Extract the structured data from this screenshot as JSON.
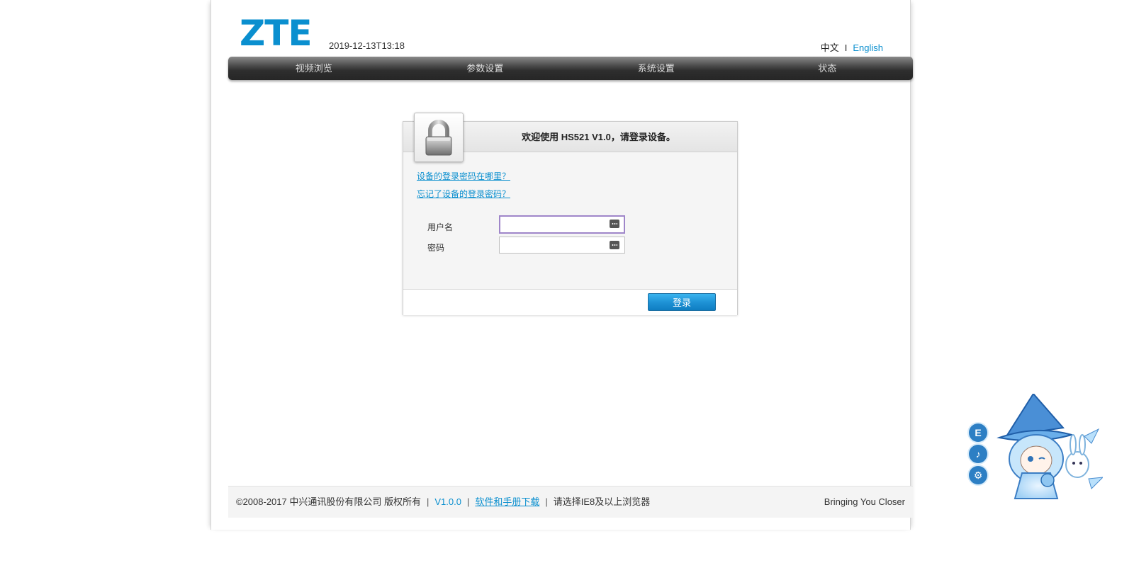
{
  "header": {
    "logo_text": "ZTE",
    "datetime": "2019-12-13T13:18",
    "lang_zh": "中文",
    "lang_separator": "I",
    "lang_en": "English"
  },
  "nav": {
    "items": [
      {
        "label": "视频浏览"
      },
      {
        "label": "参数设置"
      },
      {
        "label": "系统设置"
      },
      {
        "label": "状态"
      }
    ]
  },
  "login": {
    "title": "欢迎使用 HS521 V1.0，请登录设备。",
    "link_where_password": "设备的登录密码在哪里？",
    "link_forgot_password": "忘记了设备的登录密码？",
    "username_label": "用户名",
    "username_value": "",
    "password_label": "密码",
    "password_value": "",
    "submit_label": "登录"
  },
  "footer": {
    "copyright": "©2008-2017 中兴通讯股份有限公司 版权所有",
    "version": "V1.0.0",
    "download_link": "软件和手册下载",
    "browser_note": "请选择IE8及以上浏览器",
    "slogan": "Bringing You Closer"
  },
  "mascot": {
    "btn_e": "E",
    "btn_music": "♪",
    "btn_settings": "⚙"
  },
  "colors": {
    "brand": "#0a8fcf",
    "nav_bg": "#2e2e2e",
    "button": "#1f93d6"
  }
}
